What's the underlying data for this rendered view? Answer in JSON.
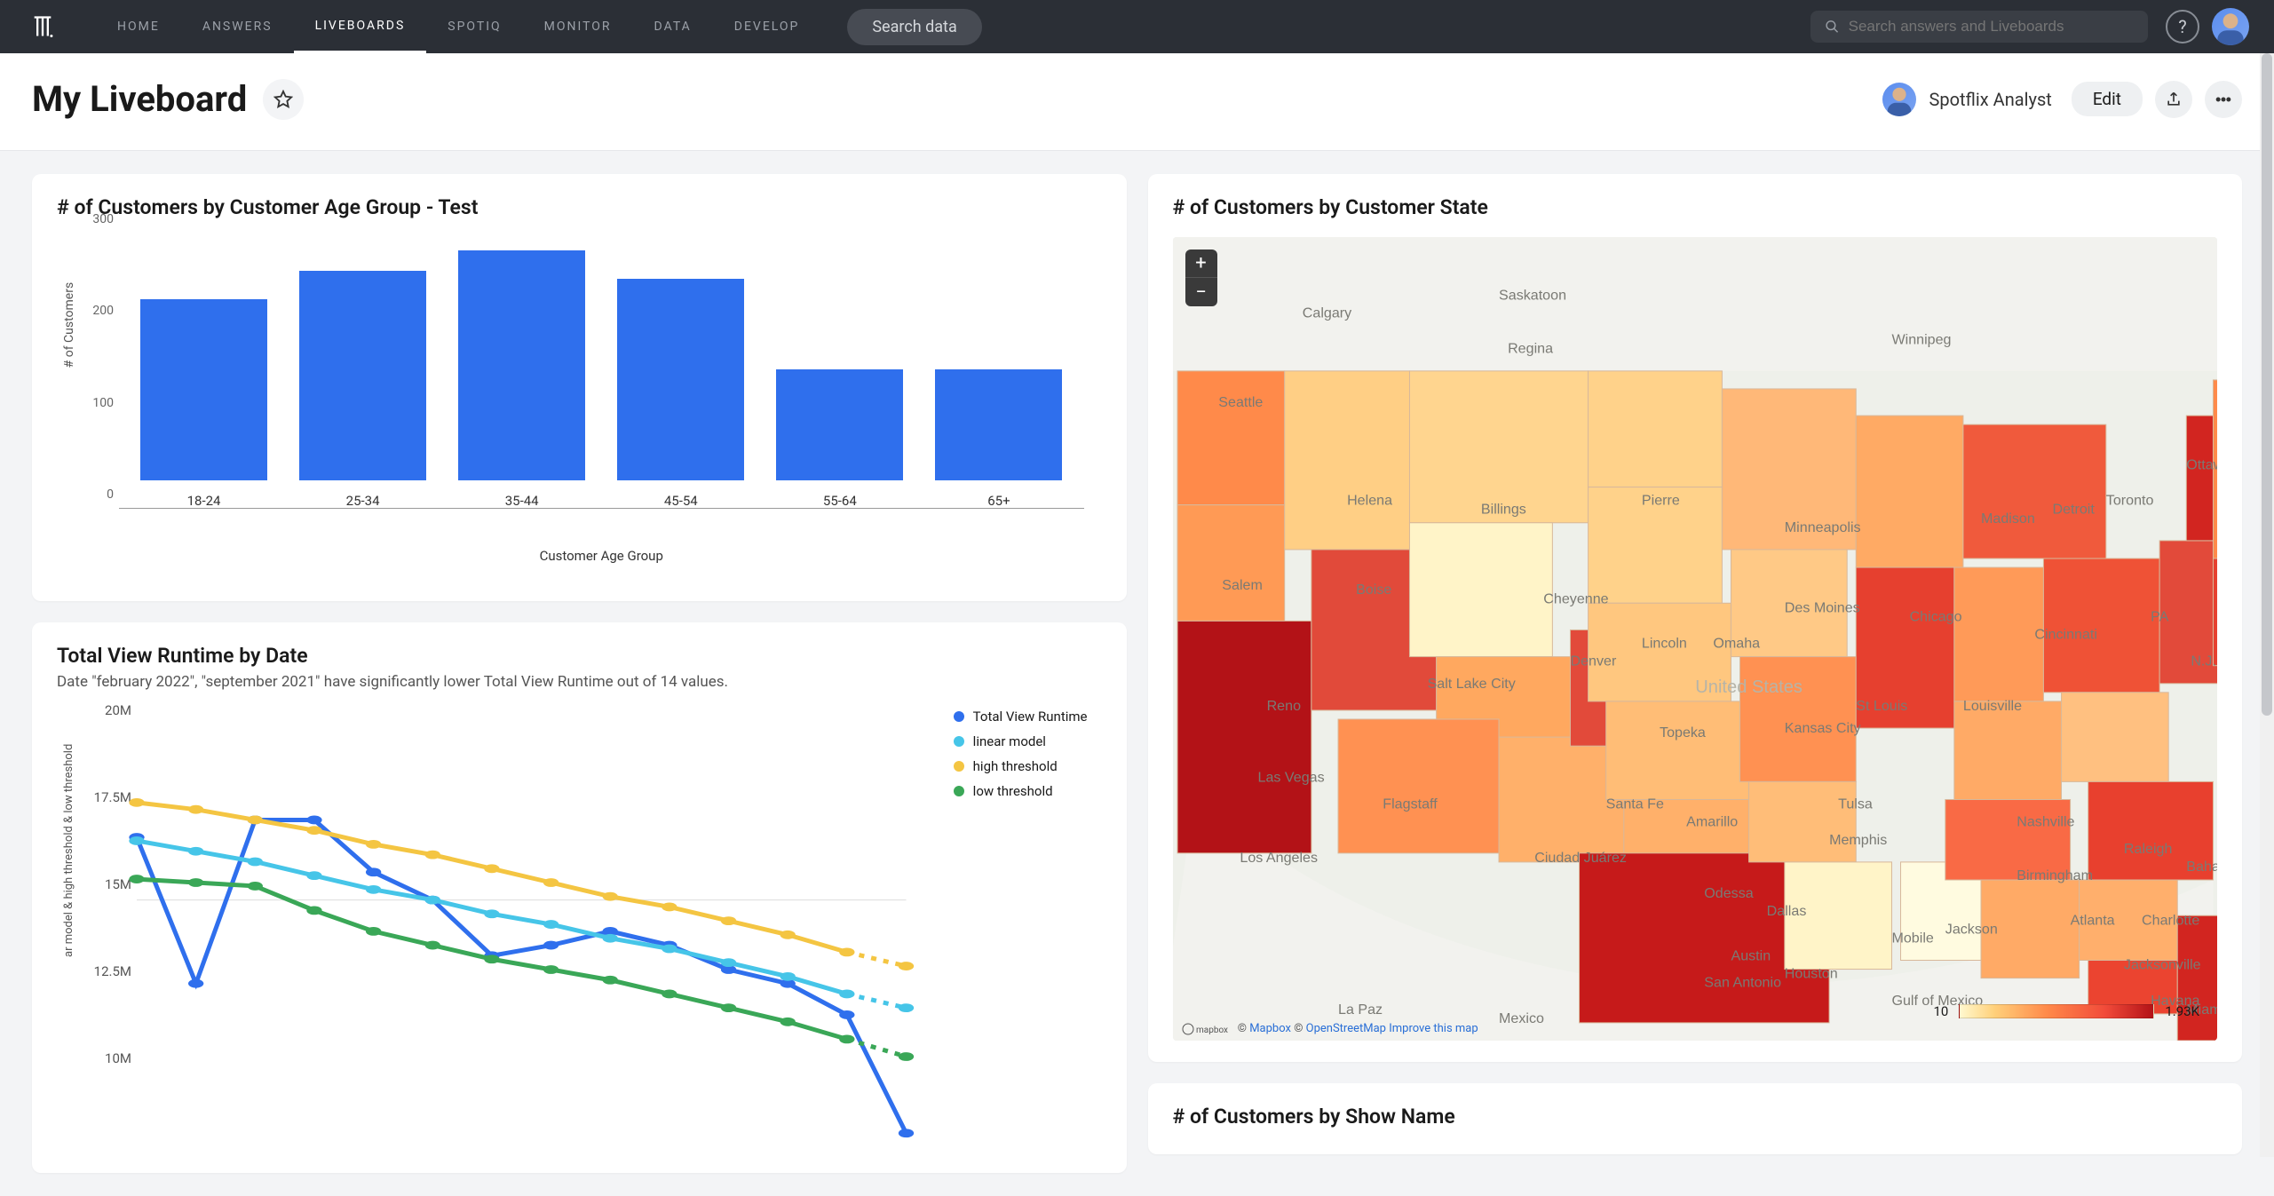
{
  "nav": {
    "items": [
      "HOME",
      "ANSWERS",
      "LIVEBOARDS",
      "SPOTIQ",
      "MONITOR",
      "DATA",
      "DEVELOP"
    ],
    "active_index": 2,
    "search_pill": "Search data",
    "search_placeholder": "Search answers and Liveboards"
  },
  "header": {
    "title": "My Liveboard",
    "author": "Spotflix Analyst",
    "edit_label": "Edit"
  },
  "cards": {
    "bar": {
      "title": "# of Customers by Customer Age Group - Test"
    },
    "line": {
      "title": "Total View Runtime by Date",
      "subtitle": "Date \"february 2022\", \"september 2021\" have significantly lower Total View Runtime out of 14 values."
    },
    "map": {
      "title": "# of Customers by Customer State",
      "scale_min": "10",
      "scale_max": "1.93K",
      "attrib_prefix": "© ",
      "attrib_mapbox": "Mapbox",
      "attrib_osm": "OpenStreetMap",
      "attrib_improve": "Improve this map"
    },
    "show": {
      "title": "# of Customers by Show Name"
    }
  },
  "chart_data": [
    {
      "id": "customers_by_age_group",
      "type": "bar",
      "title": "# of Customers by Customer Age Group - Test",
      "xlabel": "Customer Age Group",
      "ylabel": "# of Customers",
      "categories": [
        "18-24",
        "25-34",
        "35-44",
        "45-54",
        "55-64",
        "65+"
      ],
      "values": [
        220,
        255,
        280,
        245,
        135,
        135
      ],
      "yticks": [
        0,
        100,
        200,
        300
      ],
      "ylim": [
        0,
        300
      ]
    },
    {
      "id": "total_view_runtime_by_date",
      "type": "line",
      "title": "Total View Runtime by Date",
      "ylabel": "ar model & high threshold & low threshold",
      "yticks_labels": [
        "10M",
        "12.5M",
        "15M",
        "17.5M",
        "20M"
      ],
      "yticks_values": [
        10000000,
        12500000,
        15000000,
        17500000,
        20000000
      ],
      "ylim": [
        8000000,
        20500000
      ],
      "x_index": [
        0,
        1,
        2,
        3,
        4,
        5,
        6,
        7,
        8,
        9,
        10,
        11,
        12,
        13
      ],
      "series": [
        {
          "name": "Total View Runtime",
          "color": "#2f6fed",
          "values": [
            16800000,
            12600000,
            17300000,
            17300000,
            15800000,
            15000000,
            13400000,
            13700000,
            14100000,
            13700000,
            13000000,
            12600000,
            11700000,
            8300000
          ]
        },
        {
          "name": "linear model",
          "color": "#46c5e8",
          "values": [
            16700000,
            16400000,
            16100000,
            15700000,
            15300000,
            15000000,
            14600000,
            14300000,
            13900000,
            13600000,
            13200000,
            12800000,
            12300000,
            11900000
          ],
          "dashed_from_index": 12
        },
        {
          "name": "high threshold",
          "color": "#f4c542",
          "values": [
            17800000,
            17600000,
            17300000,
            17000000,
            16600000,
            16300000,
            15900000,
            15500000,
            15100000,
            14800000,
            14400000,
            14000000,
            13500000,
            13100000
          ],
          "dashed_from_index": 12
        },
        {
          "name": "low threshold",
          "color": "#3aa757",
          "values": [
            15600000,
            15500000,
            15400000,
            14700000,
            14100000,
            13700000,
            13300000,
            13000000,
            12700000,
            12300000,
            11900000,
            11500000,
            11000000,
            10500000
          ],
          "dashed_from_index": 12
        }
      ],
      "legend": [
        "Total View Runtime",
        "linear model",
        "high threshold",
        "low threshold"
      ]
    },
    {
      "id": "customers_by_state",
      "type": "heatmap",
      "title": "# of Customers by Customer State",
      "value_range": [
        10,
        1930
      ],
      "geography": "US states",
      "color_scale": [
        "#fff9cf",
        "#ffd07a",
        "#ff8a4a",
        "#f24b3a",
        "#b31217"
      ],
      "note": "State-level choropleth; approximate counts read from color intensity",
      "approx_values": {
        "CA": 1930,
        "TX": 1700,
        "NY": 1500,
        "FL": 1500,
        "PA": 1100,
        "IL": 1000,
        "OH": 950,
        "GA": 900,
        "NC": 850,
        "MI": 850,
        "NJ": 800,
        "VA": 800,
        "WA": 650,
        "AZ": 650,
        "MA": 650,
        "TN": 650,
        "IN": 600,
        "MO": 600,
        "MD": 550,
        "WI": 550,
        "CO": 750,
        "MN": 500,
        "SC": 500,
        "AL": 500,
        "LA": 400,
        "KY": 450,
        "OR": 450,
        "OK": 400,
        "CT": 400,
        "UT": 350,
        "IA": 300,
        "NV": 650,
        "AR": 300,
        "KS": 300,
        "NM": 400,
        "NE": 250,
        "WV": 200,
        "ID": 200,
        "HI": 150,
        "NH": 150,
        "ME": 150,
        "MT": 150,
        "RI": 120,
        "DE": 120,
        "SD": 100,
        "ND": 100,
        "AK": 80,
        "VT": 80,
        "WY": 60,
        "MS": 50
      }
    }
  ]
}
